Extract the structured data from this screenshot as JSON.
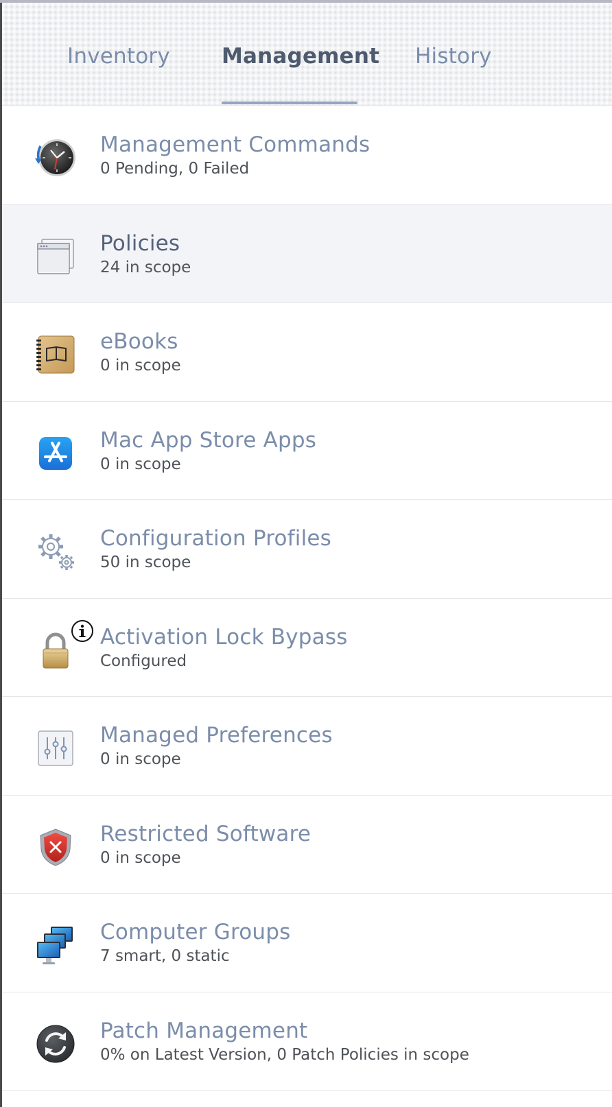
{
  "tabs": [
    {
      "label": "Inventory",
      "active": false
    },
    {
      "label": "Management",
      "active": true
    },
    {
      "label": "History",
      "active": false
    }
  ],
  "items": [
    {
      "title": "Management Commands",
      "subtitle": "0 Pending, 0 Failed",
      "icon": "clock-icon"
    },
    {
      "title": "Policies",
      "subtitle": "24 in scope",
      "icon": "window-icon"
    },
    {
      "title": "eBooks",
      "subtitle": "0 in scope",
      "icon": "book-icon"
    },
    {
      "title": "Mac App Store Apps",
      "subtitle": "0 in scope",
      "icon": "app-store-icon"
    },
    {
      "title": "Configuration Profiles",
      "subtitle": "50 in scope",
      "icon": "gears-icon"
    },
    {
      "title": "Activation Lock Bypass",
      "subtitle": "Configured",
      "icon": "padlock-icon"
    },
    {
      "title": "Managed Preferences",
      "subtitle": "0 in scope",
      "icon": "sliders-icon"
    },
    {
      "title": "Restricted Software",
      "subtitle": "0 in scope",
      "icon": "shield-icon"
    },
    {
      "title": "Computer Groups",
      "subtitle": "7 smart, 0 static",
      "icon": "computers-icon"
    },
    {
      "title": "Patch Management",
      "subtitle": "0% on Latest Version, 0 Patch Policies in scope",
      "icon": "sync-icon"
    }
  ],
  "colors": {
    "title": "#7b8daa",
    "selected_title": "#55627a",
    "subtitle": "#4f5358",
    "accent": "#95a6c2"
  }
}
